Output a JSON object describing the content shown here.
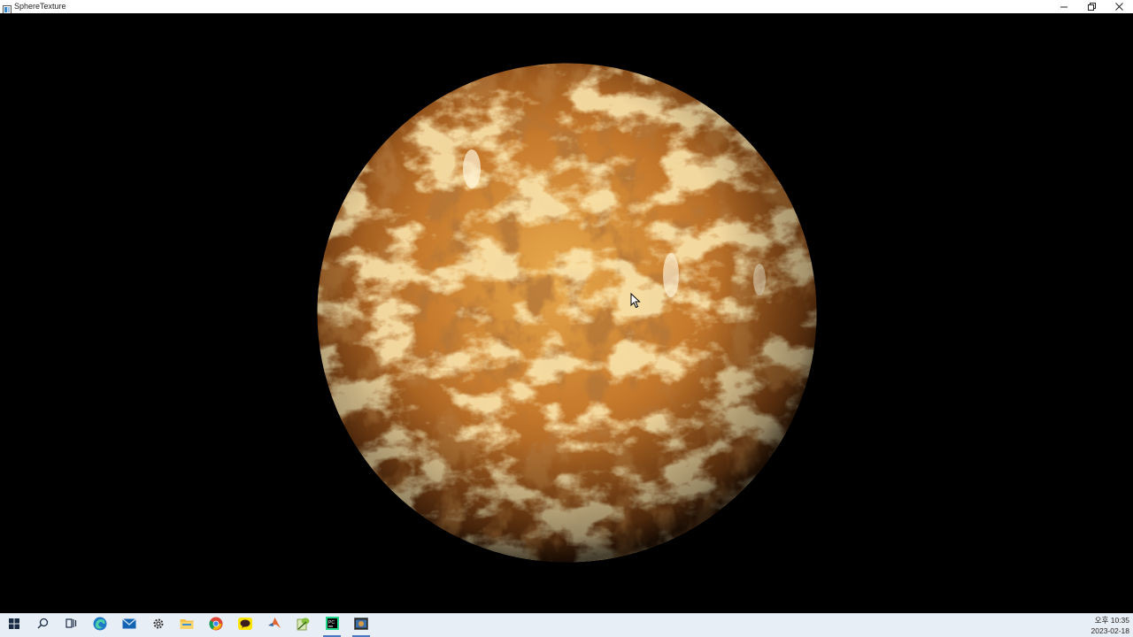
{
  "window": {
    "title": "SphereTexture",
    "controls": {
      "minimize_icon": "minimize-icon",
      "restore_icon": "restore-icon",
      "close_icon": "close-icon"
    }
  },
  "scene": {
    "object": "textured-sphere",
    "background_color": "#000000",
    "texture_colors": [
      "#f3c565",
      "#c97a2a",
      "#7a3b10",
      "#fff1c2"
    ]
  },
  "taskbar": {
    "items": [
      {
        "name": "start-icon"
      },
      {
        "name": "search-icon"
      },
      {
        "name": "task-view-icon"
      },
      {
        "name": "edge-icon"
      },
      {
        "name": "mail-icon"
      },
      {
        "name": "settings-icon"
      },
      {
        "name": "file-explorer-icon"
      },
      {
        "name": "chrome-icon"
      },
      {
        "name": "kakaotalk-icon"
      },
      {
        "name": "matlab-icon"
      },
      {
        "name": "notepad-plus-plus-icon"
      },
      {
        "name": "pycharm-icon"
      },
      {
        "name": "sphere-texture-app-icon"
      }
    ],
    "clock": {
      "time": "오후 10:35",
      "date": "2023-02-18"
    },
    "accent": "#4a78c2"
  }
}
